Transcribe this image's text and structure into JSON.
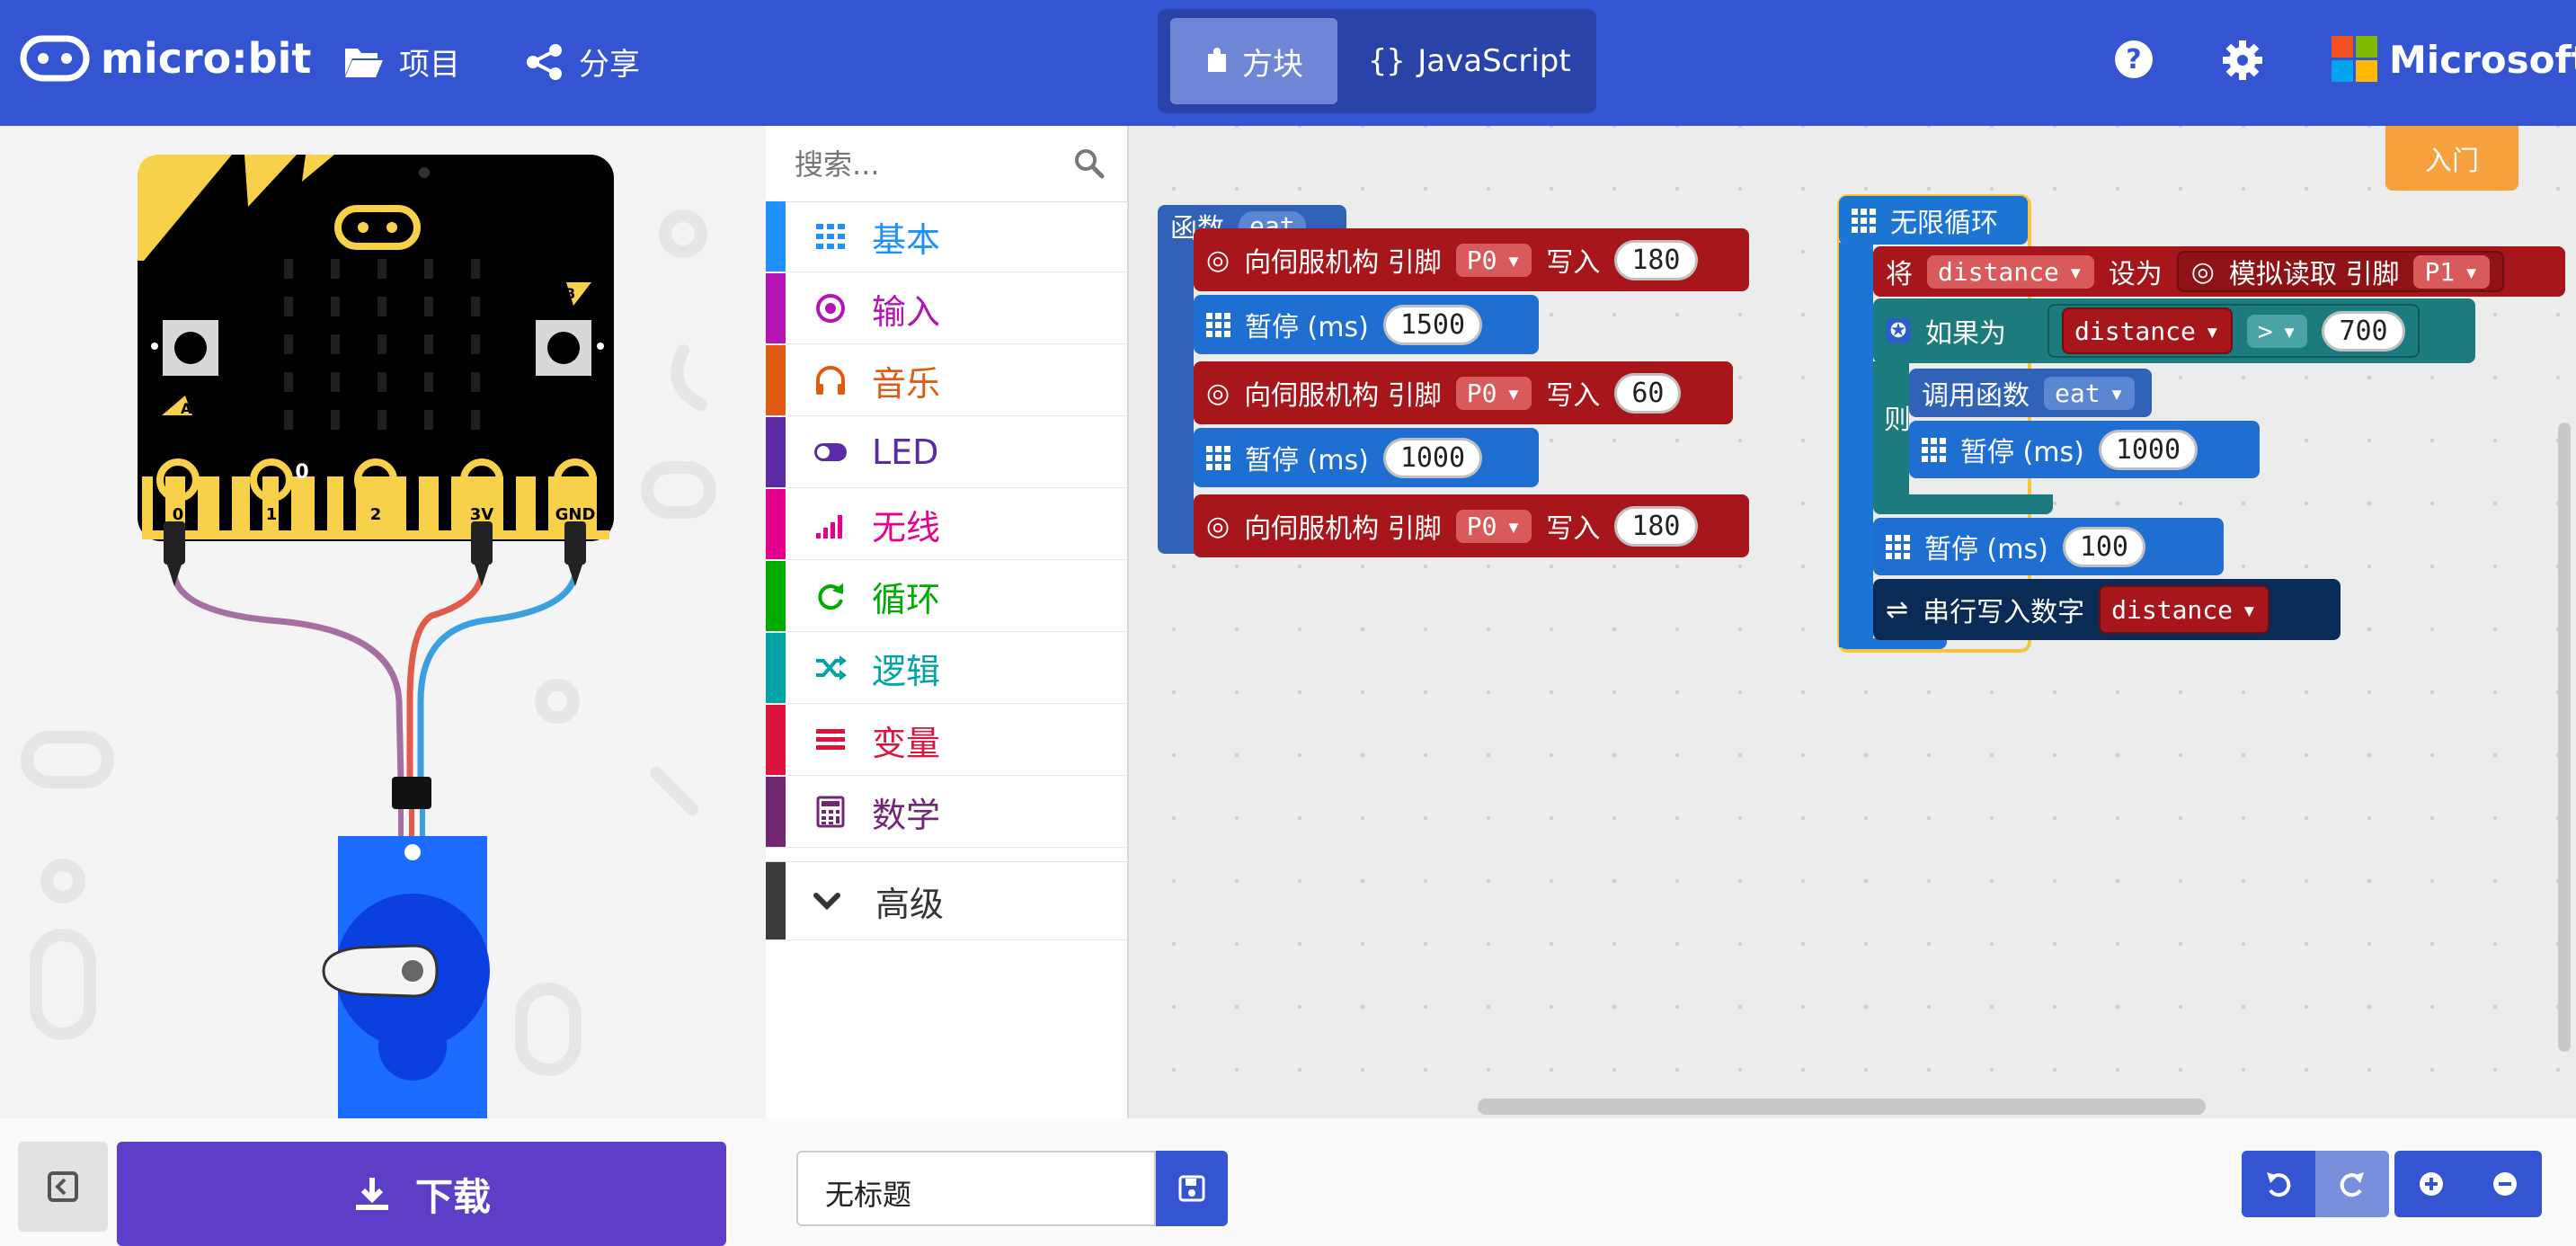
{
  "header": {
    "logo_text": "micro:bit",
    "projects_label": "项目",
    "share_label": "分享",
    "blocks_tab": "方块",
    "javascript_tab": "JavaScript",
    "microsoft_label": "Microsoft",
    "help_icon": "help-icon",
    "settings_icon": "gear-icon"
  },
  "simulator": {
    "pin_labels": [
      "0",
      "1",
      "2",
      "3V",
      "GND"
    ],
    "button_a": "A",
    "button_b": "B",
    "pin_reading": "0"
  },
  "toolbox": {
    "search_placeholder": "搜索...",
    "categories": [
      {
        "label": "基本",
        "color": "#1e90ff"
      },
      {
        "label": "输入",
        "color": "#b414b4"
      },
      {
        "label": "音乐",
        "color": "#e05b12"
      },
      {
        "label": "LED",
        "color": "#5b2ba6"
      },
      {
        "label": "无线",
        "color": "#e3008c"
      },
      {
        "label": "循环",
        "color": "#00aa00"
      },
      {
        "label": "逻辑",
        "color": "#00a4a6"
      },
      {
        "label": "变量",
        "color": "#dc143c"
      },
      {
        "label": "数学",
        "color": "#712672"
      }
    ],
    "advanced_label": "高级"
  },
  "workspace": {
    "getting_started": "入门",
    "function_block": {
      "keyword": "函数",
      "name": "eat",
      "statements": [
        {
          "type": "servo",
          "label": "向伺服机构 引脚",
          "pin": "P0",
          "write": "写入",
          "value": "180"
        },
        {
          "type": "pause",
          "label": "暂停 (ms)",
          "value": "1500"
        },
        {
          "type": "servo",
          "label": "向伺服机构 引脚",
          "pin": "P0",
          "write": "写入",
          "value": "60"
        },
        {
          "type": "pause",
          "label": "暂停 (ms)",
          "value": "1000"
        },
        {
          "type": "servo",
          "label": "向伺服机构 引脚",
          "pin": "P0",
          "write": "写入",
          "value": "180"
        }
      ]
    },
    "forever_block": {
      "label": "无限循环",
      "set_keyword": "将",
      "variable": "distance",
      "set_to": "设为",
      "analog_read": "模拟读取 引脚",
      "analog_pin": "P1",
      "if_label": "如果为",
      "compare_var": "distance",
      "operator": ">",
      "compare_value": "700",
      "then_label": "则",
      "call_label": "调用函数",
      "call_name": "eat",
      "inner_pause_label": "暂停 (ms)",
      "inner_pause_value": "1000",
      "pause_label": "暂停 (ms)",
      "pause_value": "100",
      "serial_label": "串行写入数字",
      "serial_var": "distance"
    }
  },
  "footer": {
    "download_label": "下载",
    "project_name": "无标题"
  },
  "colors": {
    "header_blue": "#3454d1",
    "download_purple": "#5c3ec7",
    "function_blue": "#3063b8",
    "servo_red": "#a6161b",
    "pause_blue": "#1e6fd1",
    "forever_blue": "#1d75d3",
    "logic_teal": "#1b7b7d",
    "serial_navy": "#0b2b57",
    "getting_started_orange": "#f6a13e"
  }
}
